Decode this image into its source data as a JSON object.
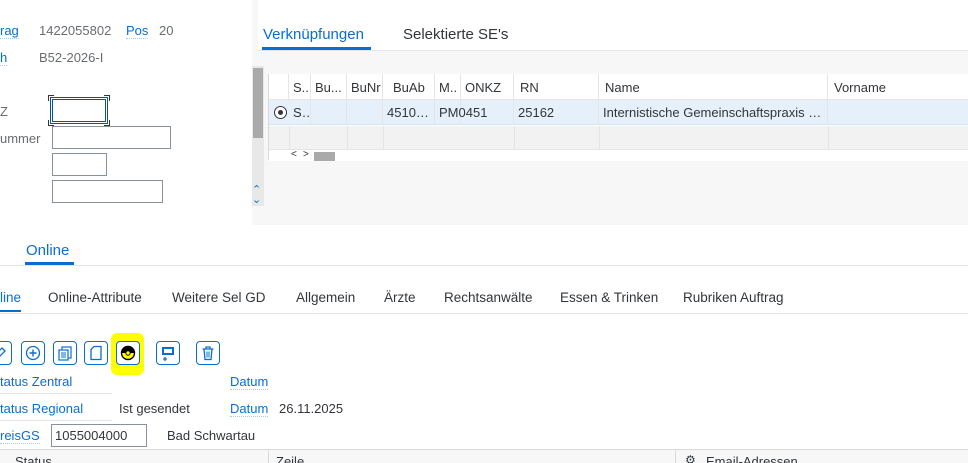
{
  "header": {
    "auftrag_label": "rag",
    "auftrag_value": "1422055802",
    "pos_label": "Pos",
    "pos_value": "20",
    "h_label": "h",
    "h_value": "B52-2026-I",
    "z_label": "Z",
    "nummer_label": "ummer",
    "fields": {
      "z_value": "",
      "nummer_value": "",
      "field3_value": "",
      "field4_value": ""
    }
  },
  "right_tabs": [
    {
      "label": "Verknüpfungen",
      "active": true
    },
    {
      "label": "Selektierte SE's",
      "active": false
    }
  ],
  "grid": {
    "columns": [
      "S..",
      "Bu...",
      "BuNr",
      "BuAb",
      "M..",
      "ONKZ",
      "RN",
      "Name",
      "Vorname"
    ],
    "rows": [
      {
        "selected": true,
        "cells": [
          "SE",
          "",
          "",
          "451005",
          "PM0451",
          "",
          "25162",
          "Internistische Gemeinschaftspraxis B...",
          ""
        ]
      }
    ],
    "scroll_left": "<",
    "scroll_right": ">"
  },
  "section_tab": {
    "label": "Online"
  },
  "subtabs": [
    {
      "label": "line",
      "active": true
    },
    {
      "label": "Online-Attribute",
      "active": false
    },
    {
      "label": "Weitere Sel GD",
      "active": false
    },
    {
      "label": "Allgemein",
      "active": false
    },
    {
      "label": "Ärzte",
      "active": false
    },
    {
      "label": "Rechtsanwälte",
      "active": false
    },
    {
      "label": "Essen & Trinken",
      "active": false
    },
    {
      "label": "Rubriken Auftrag",
      "active": false
    }
  ],
  "toolbar_icons": [
    "edit-icon",
    "add-circle-icon",
    "copy-documents-icon",
    "new-document-icon",
    "status-circle-icon",
    "add-screen-icon",
    "trash-icon"
  ],
  "form": {
    "status_zentral_label": "tatus Zentral",
    "datum1_label": "Datum",
    "datum1_value": "",
    "status_regional_label": "tatus Regional",
    "status_regional_value": "Ist gesendet",
    "datum2_label": "Datum",
    "datum2_value": "26.11.2025",
    "kreisgs_label": "reisGS",
    "kreisgs_value": "1055004000",
    "city": "Bad Schwartau"
  },
  "bottom_table": {
    "status_header": "Status",
    "zeile_header": "Zeile",
    "email_header": "Email-Adressen"
  },
  "colors": {
    "accent": "#0a6ed1",
    "highlight": "#ffff00"
  }
}
